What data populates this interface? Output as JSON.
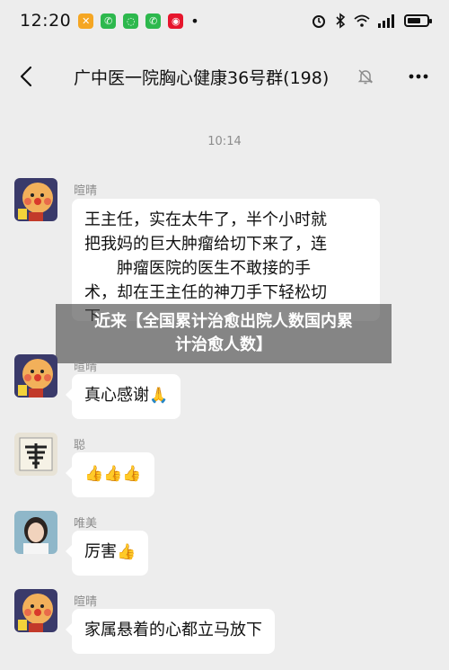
{
  "status_bar": {
    "time": "12:20",
    "app_icons": [
      {
        "name": "app-icon-1",
        "color": "#f5a623",
        "glyph": "✕"
      },
      {
        "name": "wechat-icon",
        "color": "#2db84d",
        "glyph": "✆"
      },
      {
        "name": "app-icon-3",
        "color": "#2db84d",
        "glyph": "◌"
      },
      {
        "name": "wechat-icon-2",
        "color": "#2db84d",
        "glyph": "✆"
      },
      {
        "name": "weibo-icon",
        "color": "#e6162d",
        "glyph": "◉"
      },
      {
        "name": "dot",
        "color": "#111111",
        "glyph": "•"
      }
    ],
    "right_text": "⌖ ✱ ᯤ ıll"
  },
  "header": {
    "title": "广中医一院胸心健康36号群(198)",
    "back_icon": "chevron-left-icon",
    "mute_icon": "bell-muted-icon",
    "more_icon": "more-dots-icon"
  },
  "timestamp": "10:14",
  "messages": [
    {
      "sender": "暄晴",
      "lines": [
        "王主任，实在太牛了，半个小时就",
        "把我妈的巨大肿瘤给切下来了，连",
        "肿瘤医院的医生不敢接的手",
        "术，却在王主任的神刀手下轻松切",
        "下"
      ]
    },
    {
      "sender": "暄晴",
      "text": "真心感谢",
      "emoji": "🙏"
    },
    {
      "sender": "聪",
      "emoji_text": "👍👍👍"
    },
    {
      "sender": "唯美",
      "text": "厉害",
      "emoji": "👍"
    },
    {
      "sender": "暄晴",
      "text": "家属悬着的心都立马放下"
    }
  ],
  "overlay": {
    "line1": "近来【全国累计治愈出院人数国内累",
    "line2": "计治愈人数】"
  },
  "colors": {
    "background": "#ededed",
    "bubble": "#ffffff",
    "meta_text": "#8c8c8c"
  }
}
